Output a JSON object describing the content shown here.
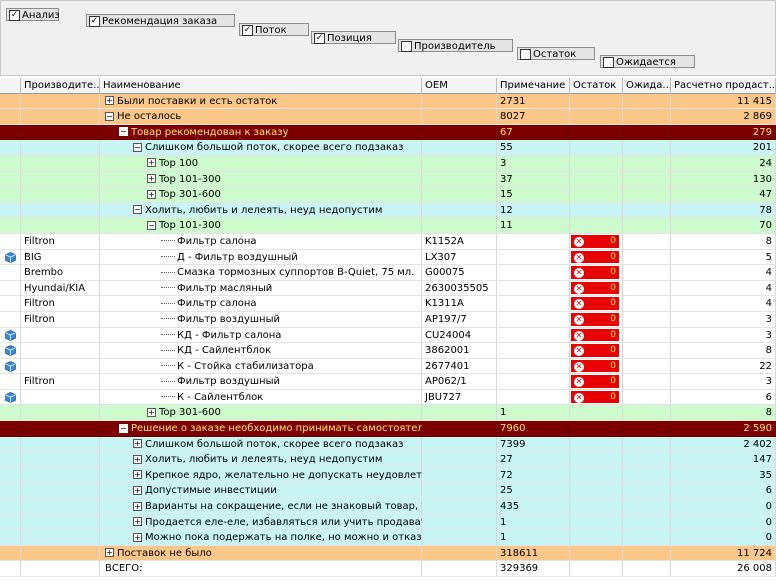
{
  "group_chips": [
    {
      "label": "Анализ",
      "checked": true
    },
    {
      "label": "Рекомендация заказа",
      "checked": true
    },
    {
      "label": "Поток",
      "checked": true
    },
    {
      "label": "Позиция",
      "checked": true
    },
    {
      "label": "Производитель",
      "checked": false
    },
    {
      "label": "Остаток",
      "checked": false
    },
    {
      "label": "Ожидается",
      "checked": false
    }
  ],
  "columns": [
    "Производите...",
    "Наименование",
    "OEM",
    "Примечание",
    "Остаток",
    "Ожида...",
    "Расчетно продаст..."
  ],
  "rows": [
    {
      "style": "orange",
      "depth": 0,
      "node": "plus",
      "name": "Были поставки и есть остаток",
      "note": "2731",
      "calc": "11 415"
    },
    {
      "style": "orange",
      "depth": 0,
      "node": "minus",
      "name": "Не осталось",
      "note": "8027",
      "calc": "2 869"
    },
    {
      "style": "dark",
      "depth": 1,
      "node": "minus",
      "name": "Товар рекомендован к заказу",
      "note": "67",
      "calc": "279"
    },
    {
      "style": "cyan",
      "depth": 2,
      "node": "minus",
      "name": "Слишком большой поток, скорее всего подзаказ",
      "note": "55",
      "calc": "201"
    },
    {
      "style": "green",
      "depth": 3,
      "node": "plus",
      "name": "Top 100",
      "note": "3",
      "calc": "24"
    },
    {
      "style": "green",
      "depth": 3,
      "node": "plus",
      "name": "Top 101-300",
      "note": "37",
      "calc": "130"
    },
    {
      "style": "green",
      "depth": 3,
      "node": "plus",
      "name": "Top 301-600",
      "note": "15",
      "calc": "47"
    },
    {
      "style": "cyan",
      "depth": 2,
      "node": "minus",
      "name": "Холить, любить и лелеять, неуд недопустим",
      "note": "12",
      "calc": "78"
    },
    {
      "style": "green",
      "depth": 3,
      "node": "minus",
      "name": "Top 101-300",
      "note": "11",
      "calc": "70"
    },
    {
      "style": "white",
      "depth": 4,
      "node": "leaf",
      "maker": "Filtron",
      "name": "Фильтр салона",
      "oem": "K1152A",
      "stock": "0",
      "calc": "8"
    },
    {
      "style": "white",
      "depth": 4,
      "node": "leaf",
      "cube": true,
      "maker": "BIG",
      "name": "Д - Фильтр воздушный",
      "oem": "LX307",
      "stock": "0",
      "calc": "5"
    },
    {
      "style": "white",
      "depth": 4,
      "node": "leaf",
      "maker": "Brembo",
      "name": "Смазка тормозных суппортов B-Quiet, 75 мл.",
      "oem": "G00075",
      "stock": "0",
      "calc": "4"
    },
    {
      "style": "white",
      "depth": 4,
      "node": "leaf",
      "maker": "Hyundai/KIA",
      "name": "Фильтр масляный",
      "oem": "2630035505",
      "stock": "0",
      "calc": "4"
    },
    {
      "style": "white",
      "depth": 4,
      "node": "leaf",
      "maker": "Filtron",
      "name": "Фильтр салона",
      "oem": "K1311A",
      "stock": "0",
      "calc": "4"
    },
    {
      "style": "white",
      "depth": 4,
      "node": "leaf",
      "maker": "Filtron",
      "name": "Фильтр воздушный",
      "oem": "AP197/7",
      "stock": "0",
      "calc": "3"
    },
    {
      "style": "white",
      "depth": 4,
      "node": "leaf",
      "cube": true,
      "maker": "",
      "name": "КД - Фильтр салона",
      "oem": "CU24004",
      "stock": "0",
      "calc": "3"
    },
    {
      "style": "white",
      "depth": 4,
      "node": "leaf",
      "cube": true,
      "maker": "",
      "name": "КД - Сайлентблок",
      "oem": "3862001",
      "stock": "0",
      "calc": "8"
    },
    {
      "style": "white",
      "depth": 4,
      "node": "leaf",
      "cube": true,
      "maker": "",
      "name": "К - Стойка стабилизатора",
      "oem": "2677401",
      "stock": "0",
      "calc": "22"
    },
    {
      "style": "white",
      "depth": 4,
      "node": "leaf",
      "maker": "Filtron",
      "name": "Фильтр воздушный",
      "oem": "AP062/1",
      "stock": "0",
      "calc": "3"
    },
    {
      "style": "white",
      "depth": 4,
      "node": "leaf",
      "cube": true,
      "maker": "",
      "name": "К - Сайлентблок",
      "oem": "JBU727",
      "stock": "0",
      "calc": "6"
    },
    {
      "style": "green",
      "depth": 3,
      "node": "plus",
      "name": "Top 301-600",
      "note": "1",
      "calc": "8"
    },
    {
      "style": "dark",
      "depth": 1,
      "node": "minus",
      "name": "Решение о заказе необходимо принимать самостоятельно",
      "note": "7960",
      "calc": "2 590"
    },
    {
      "style": "cyan",
      "depth": 2,
      "node": "plus",
      "name": "Слишком большой поток, скорее всего подзаказ",
      "note": "7399",
      "calc": "2 402"
    },
    {
      "style": "cyan",
      "depth": 2,
      "node": "plus",
      "name": "Холить, любить и лелеять, неуд недопустим",
      "note": "27",
      "calc": "147"
    },
    {
      "style": "cyan",
      "depth": 2,
      "node": "plus",
      "name": "Крепкое ядро, желательно не допускать неудовлетворенного спр...",
      "note": "72",
      "calc": "35"
    },
    {
      "style": "cyan",
      "depth": 2,
      "node": "plus",
      "name": "Допустимые инвестиции",
      "note": "25",
      "calc": "6"
    },
    {
      "style": "cyan",
      "depth": 2,
      "node": "plus",
      "name": "Варианты на сокращение, если не знаковый товар, то надо изба...",
      "note": "435",
      "calc": "0"
    },
    {
      "style": "cyan",
      "depth": 2,
      "node": "plus",
      "name": "Продается еле-еле, избавляться или учить продавать",
      "note": "1",
      "calc": "0"
    },
    {
      "style": "cyan",
      "depth": 2,
      "node": "plus",
      "name": "Можно пока подержать на полке, но можно и отказываться",
      "note": "1",
      "calc": "0"
    },
    {
      "style": "orange",
      "depth": 0,
      "node": "plus",
      "name": "Поставок не было",
      "note": "318611",
      "calc": "11 724"
    },
    {
      "style": "white",
      "depth": 0,
      "node": "none",
      "name": "ВСЕГО:",
      "note": "329369",
      "calc": "26 008"
    }
  ]
}
